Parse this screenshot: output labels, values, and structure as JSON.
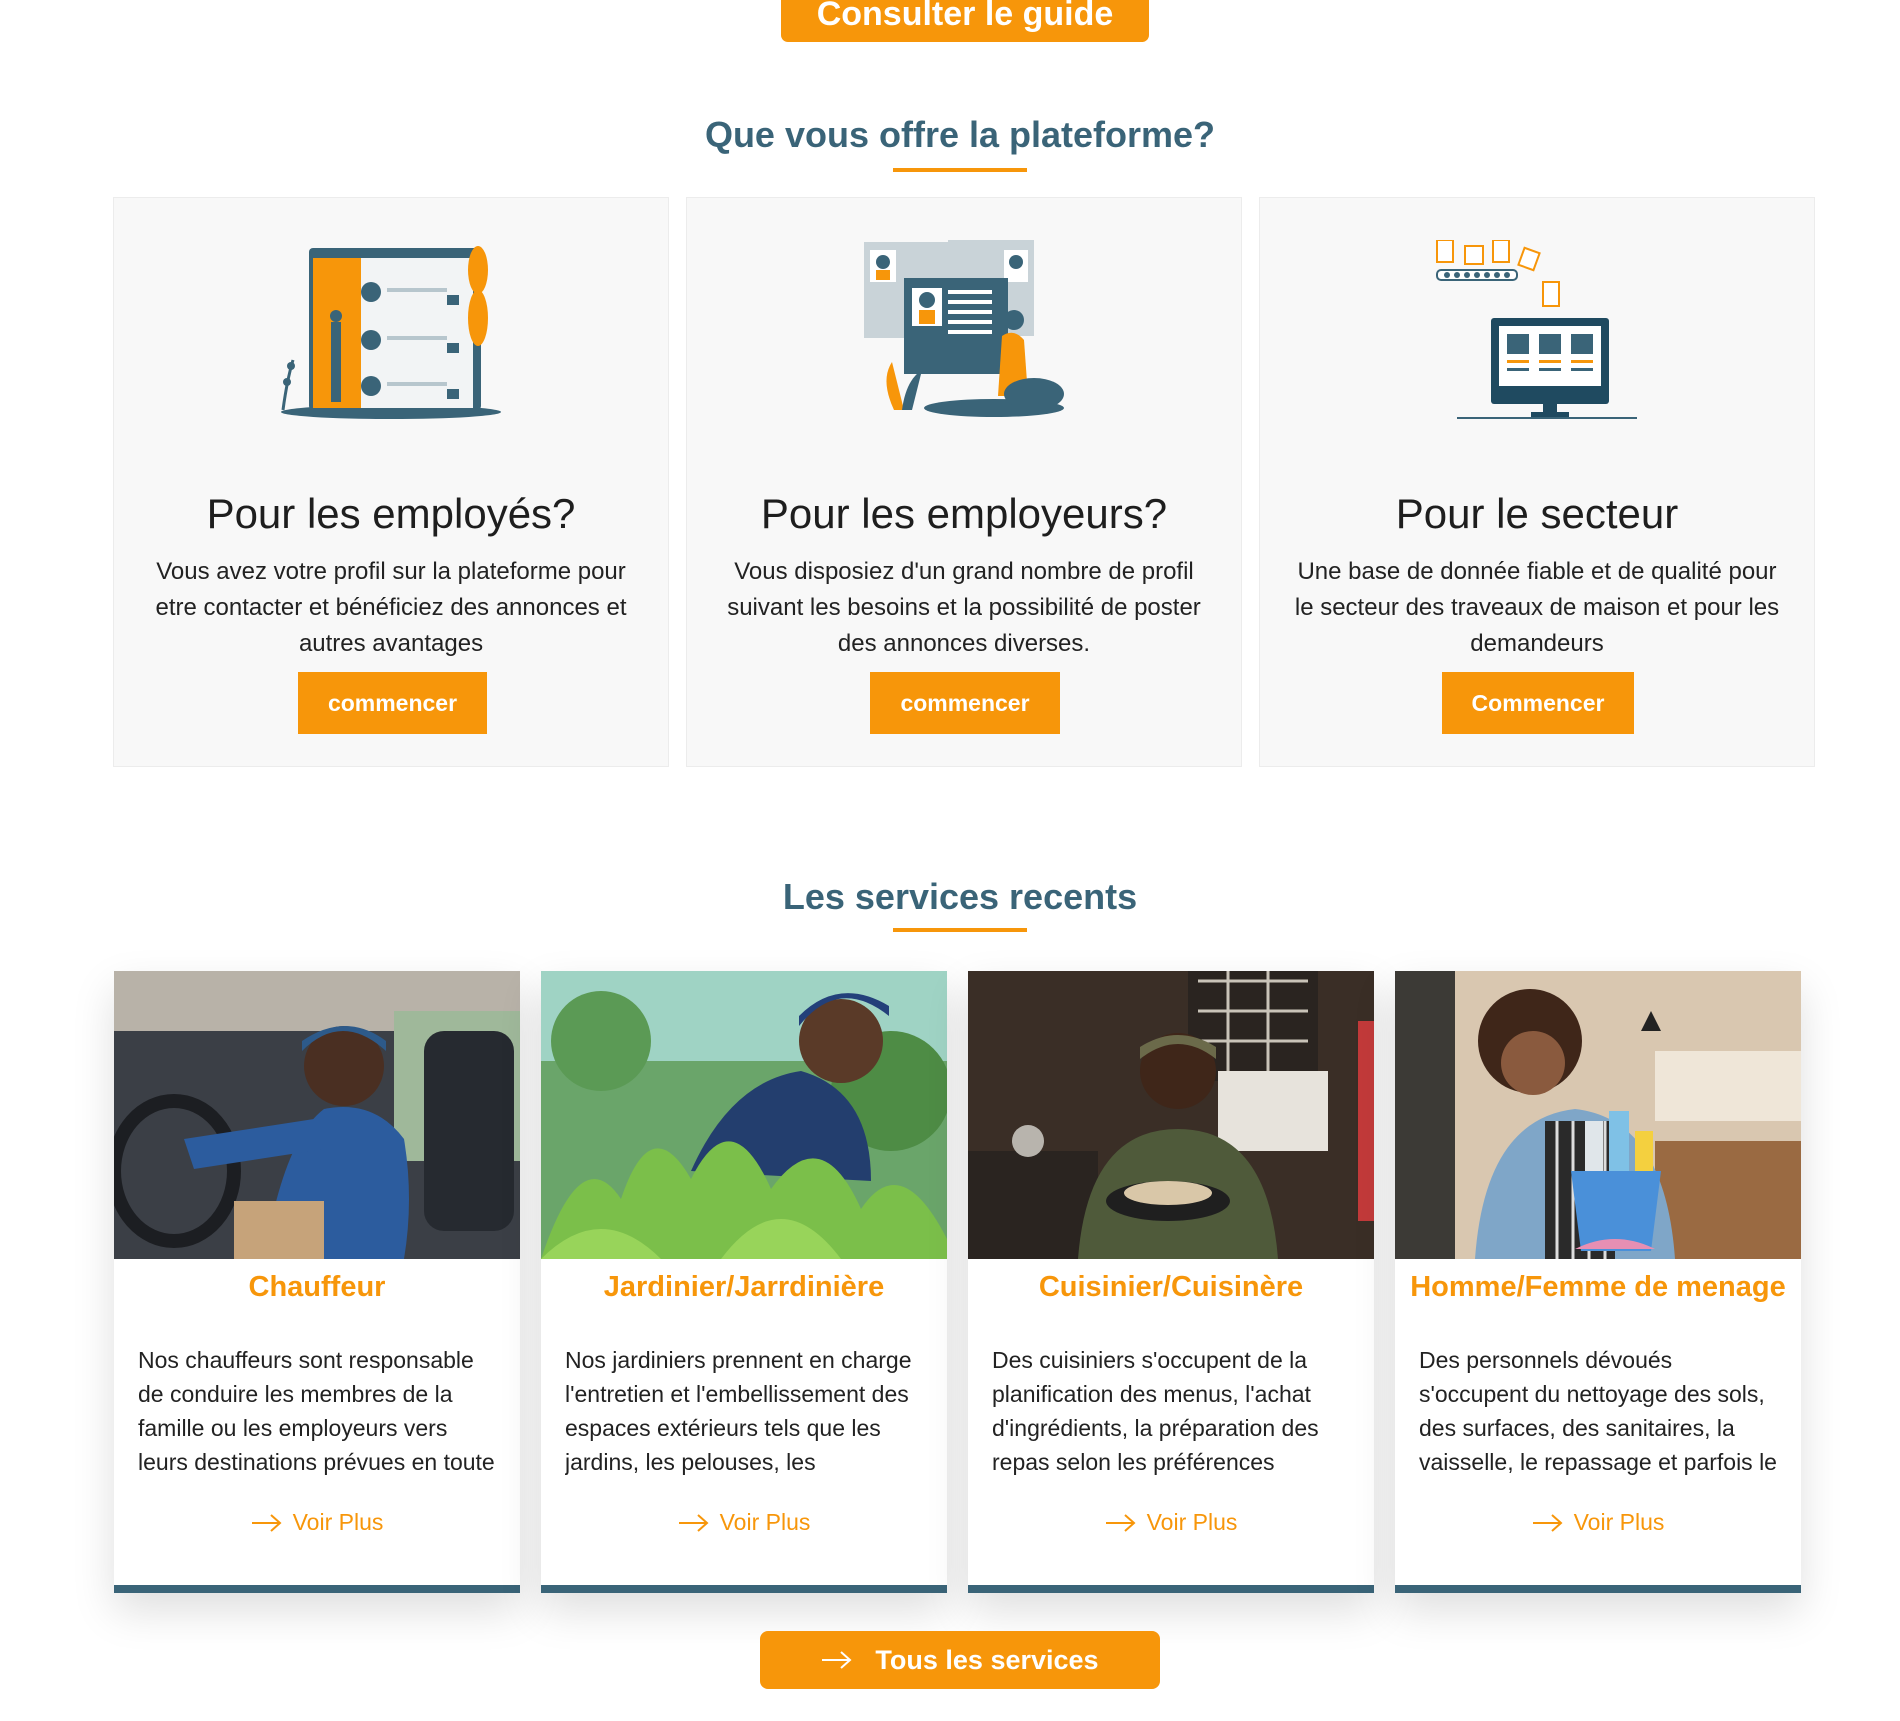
{
  "hero": {
    "guide_button": "Consulter le guide"
  },
  "offer": {
    "title": "Que vous offre la plateforme?",
    "cards": [
      {
        "icon": "employees-illustration",
        "title": "Pour les employés?",
        "text": "Vous avez votre profil sur la plateforme pour etre contacter et bénéficiez des annonces et autres avantages",
        "button": "commencer"
      },
      {
        "icon": "employers-illustration",
        "title": "Pour les employeurs?",
        "text": "Vous disposiez d'un grand nombre de profil suivant les besoins et la possibilité de poster des annonces diverses.",
        "button": "commencer"
      },
      {
        "icon": "sector-illustration",
        "title": "Pour le secteur",
        "text": "Une base de donnée fiable et de qualité pour le secteur des traveaux de maison et pour les demandeurs",
        "button": "Commencer"
      }
    ]
  },
  "services": {
    "title": "Les services recents",
    "items": [
      {
        "title": "Chauffeur",
        "description": "Nos chauffeurs sont responsable de conduire les membres de la famille ou les employeurs vers leurs destinations prévues en toute",
        "link": "Voir Plus"
      },
      {
        "title": "Jardinier/Jarrdinière",
        "description": "Nos jardiniers prennent en charge l'entretien et l'embellissement des espaces extérieurs tels que les jardins, les pelouses, les",
        "link": "Voir Plus"
      },
      {
        "title": "Cuisinier/Cuisinère",
        "description": "Des cuisiniers s'occupent de la planification des menus, l'achat d'ingrédients, la préparation des repas selon les préférences",
        "link": "Voir Plus"
      },
      {
        "title": "Homme/Femme de menage",
        "description": "Des personnels dévoués s'occupent du nettoyage des sols, des surfaces, des sanitaires, la vaisselle, le repassage et parfois le",
        "link": "Voir Plus"
      }
    ],
    "all_button": "Tous les services"
  },
  "colors": {
    "accent": "#f7960a",
    "primary": "#3a6478",
    "card_bg": "#f8f8f8"
  }
}
